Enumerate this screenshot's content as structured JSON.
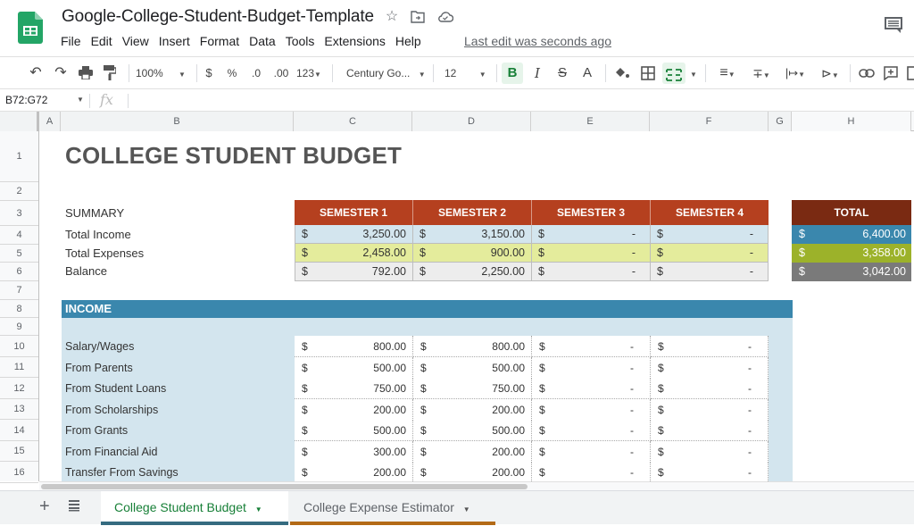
{
  "app": {
    "doc_title": "Google-College-Student-Budget-Template",
    "menu": [
      "File",
      "Edit",
      "View",
      "Insert",
      "Format",
      "Data",
      "Tools",
      "Extensions",
      "Help"
    ],
    "last_edit": "Last edit was seconds ago"
  },
  "toolbar": {
    "zoom": "100%",
    "currency": "$",
    "percent": "%",
    "dec_decrease": ".0",
    "dec_increase": ".00",
    "number_format": "123",
    "font": "Century Go...",
    "font_size": "12",
    "bold": "B",
    "italic": "I",
    "strike": "S",
    "text_color": "A"
  },
  "formula_bar": {
    "name_box": "B72:G72",
    "fx": "fx",
    "value": ""
  },
  "columns": [
    "A",
    "B",
    "C",
    "D",
    "E",
    "F",
    "G",
    "H"
  ],
  "rows": [
    "1",
    "2",
    "3",
    "4",
    "5",
    "6",
    "7",
    "8",
    "9",
    "10",
    "11",
    "12",
    "13",
    "14",
    "15",
    "16"
  ],
  "sheet": {
    "title": "COLLEGE STUDENT BUDGET",
    "summary": {
      "label": "SUMMARY",
      "headers": [
        "SEMESTER 1",
        "SEMESTER 2",
        "SEMESTER 3",
        "SEMESTER 4"
      ],
      "total_header": "TOTAL",
      "currency": "$",
      "rows": [
        {
          "label": "Total Income",
          "values": [
            "3,250.00",
            "3,150.00",
            "-",
            "-"
          ],
          "total": "6,400.00"
        },
        {
          "label": "Total Expenses",
          "values": [
            "2,458.00",
            "900.00",
            "-",
            "-"
          ],
          "total": "3,358.00"
        },
        {
          "label": "Balance",
          "values": [
            "792.00",
            "2,250.00",
            "-",
            "-"
          ],
          "total": "3,042.00"
        }
      ]
    },
    "income": {
      "header": "INCOME",
      "currency": "$",
      "rows": [
        {
          "label": "Salary/Wages",
          "values": [
            "800.00",
            "800.00",
            "-",
            "-"
          ]
        },
        {
          "label": "From Parents",
          "values": [
            "500.00",
            "500.00",
            "-",
            "-"
          ]
        },
        {
          "label": "From Student Loans",
          "values": [
            "750.00",
            "750.00",
            "-",
            "-"
          ]
        },
        {
          "label": "From Scholarships",
          "values": [
            "200.00",
            "200.00",
            "-",
            "-"
          ]
        },
        {
          "label": "From Grants",
          "values": [
            "500.00",
            "500.00",
            "-",
            "-"
          ]
        },
        {
          "label": "From Financial Aid",
          "values": [
            "300.00",
            "200.00",
            "-",
            "-"
          ]
        },
        {
          "label": "Transfer From Savings",
          "values": [
            "200.00",
            "200.00",
            "-",
            "-"
          ]
        }
      ]
    }
  },
  "tabs": {
    "add": "+",
    "items": [
      "College Student Budget",
      "College Expense Estimator"
    ]
  },
  "colors": {
    "semester_header": "#b5401f",
    "total_header": "#7a2a12",
    "income_row": "#d3e5ee",
    "expense_row": "#e4ec9c",
    "balance_row": "#ededed",
    "total_income": "#3a87ad",
    "total_expense": "#9cb22a",
    "total_balance": "#7a7a7a",
    "income_bar": "#3a87ad",
    "income_body": "#d3e5ee",
    "tab1_accent": "#356b80",
    "tab2_accent": "#b36a16"
  }
}
